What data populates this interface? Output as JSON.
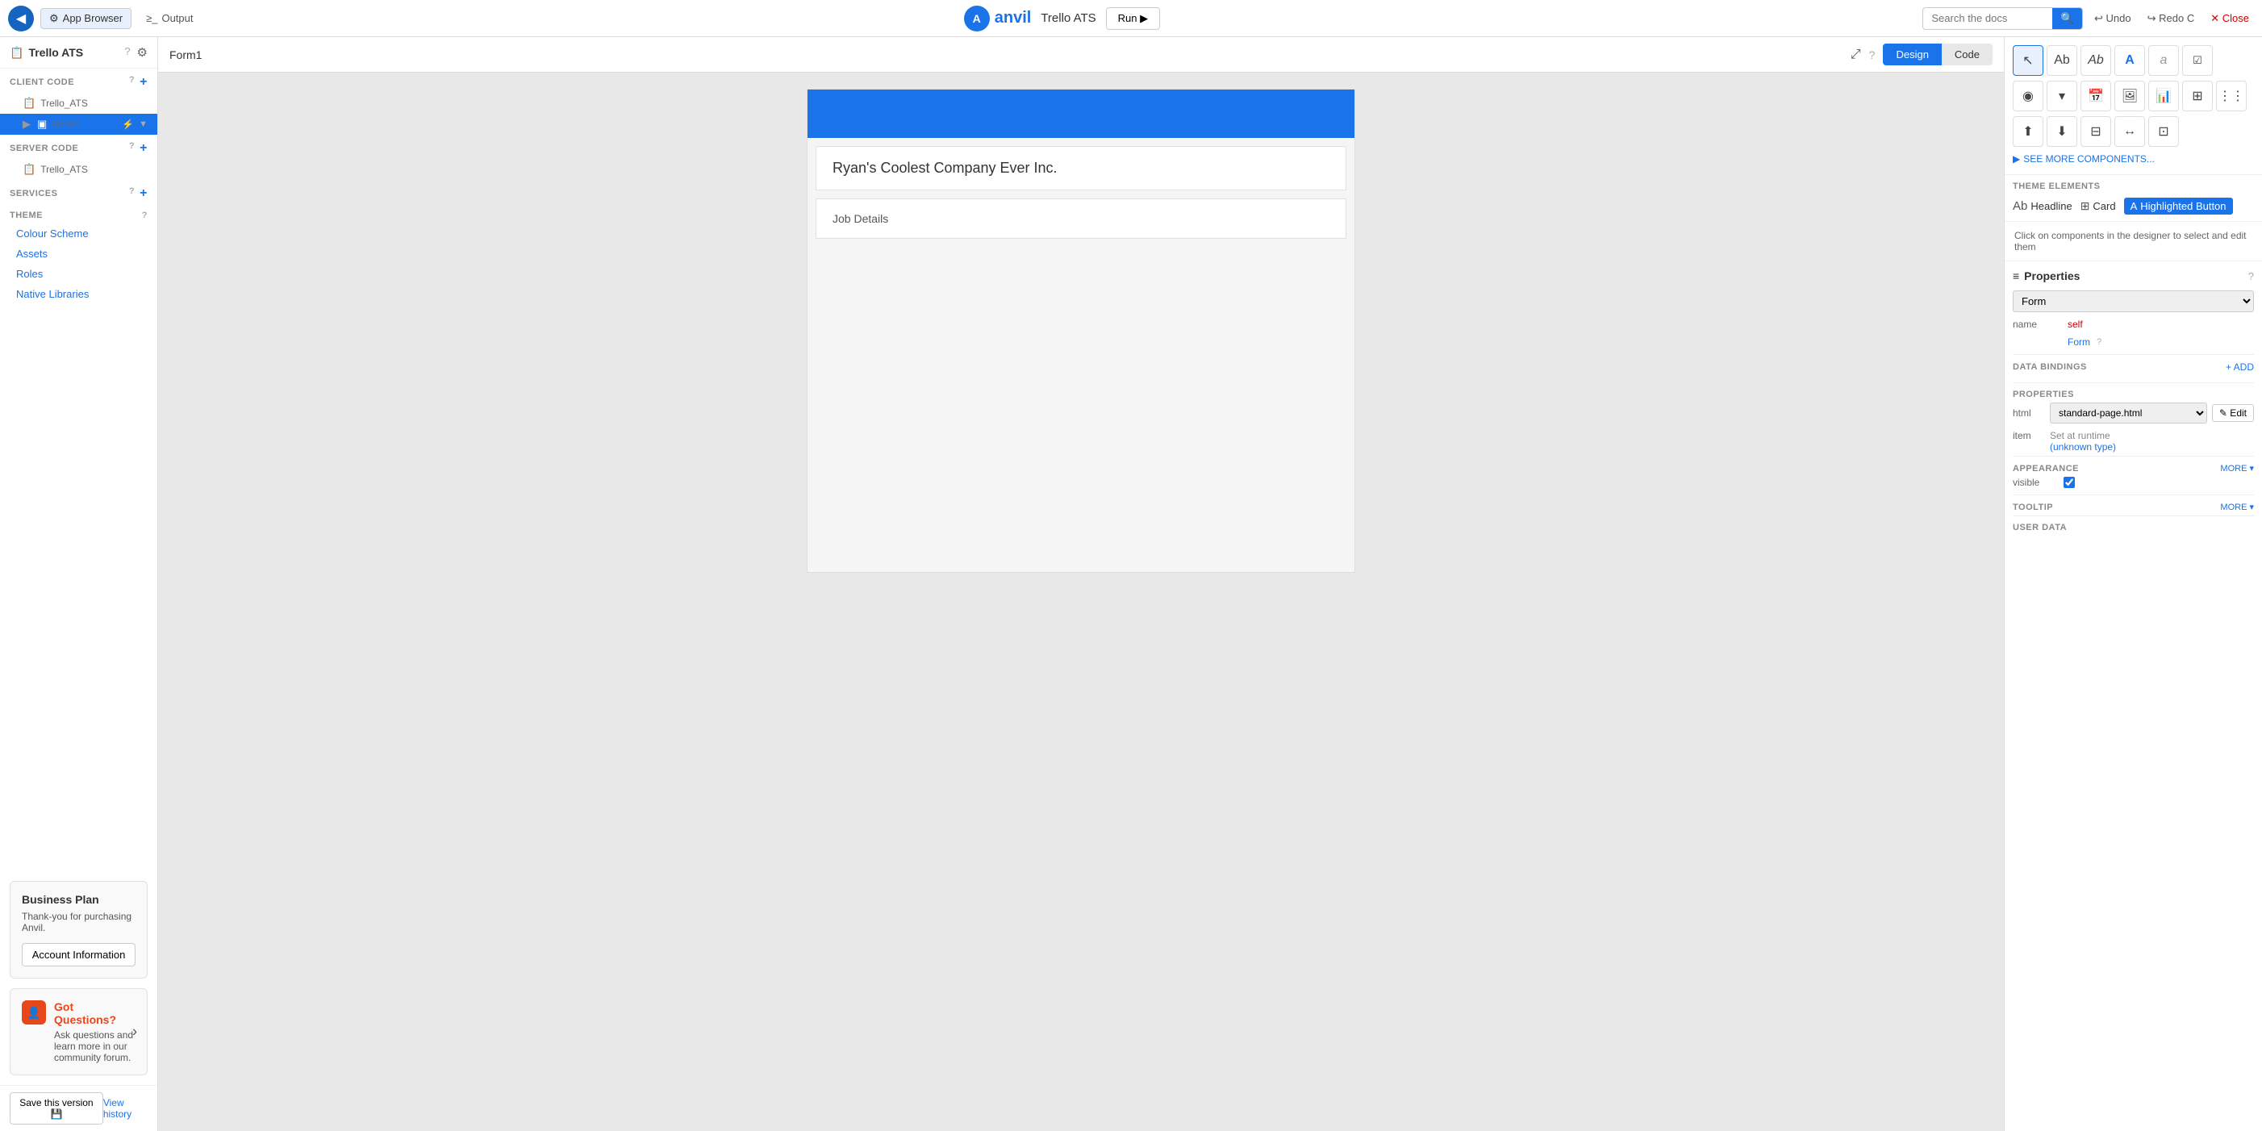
{
  "topbar": {
    "back_btn_label": "◀",
    "app_browser_label": "App Browser",
    "output_label": "Output",
    "anvil_logo_text": "anvil",
    "project_name": "Trello ATS",
    "run_label": "Run ▶",
    "search_placeholder": "Search the docs",
    "undo_label": "Undo",
    "redo_label": "Redo C",
    "close_label": "Close"
  },
  "sidebar": {
    "title": "Trello ATS",
    "sections": {
      "client_code": "CLIENT CODE",
      "server_code": "SERVER CODE",
      "services": "SERVICES",
      "theme": "THEME"
    },
    "client_items": [
      {
        "label": "Trello_ATS",
        "icon": "📋"
      },
      {
        "label": "Form1",
        "icon": "▣",
        "active": true
      }
    ],
    "server_items": [
      {
        "label": "Trello_ATS",
        "icon": "📋"
      }
    ],
    "theme_items": [
      {
        "label": "Colour Scheme"
      },
      {
        "label": "Assets"
      },
      {
        "label": "Roles"
      },
      {
        "label": "Native Libraries"
      }
    ],
    "business_plan": {
      "title": "Business Plan",
      "desc": "Thank-you for purchasing Anvil.",
      "button_label": "Account Information"
    },
    "got_questions": {
      "title": "Got Questions?",
      "desc": "Ask questions and learn more in our community forum."
    },
    "save_btn": "Save this version 💾",
    "view_history": "View history"
  },
  "form_editor": {
    "title": "Form1",
    "design_tab": "Design",
    "code_tab": "Code",
    "canvas": {
      "company_name": "Ryan's Coolest Company Ever Inc.",
      "job_details": "Job Details"
    }
  },
  "right_panel": {
    "see_more_label": "SEE MORE COMPONENTS...",
    "theme_elements_title": "THEME ELEMENTS",
    "theme_headline_label": "Headline",
    "theme_card_label": "Card",
    "theme_hbtn_label": "Highlighted Button",
    "click_hint": "Click on components in the designer to select and edit them",
    "properties_title": "Properties",
    "form_label": "Form",
    "name_label": "name",
    "name_value": "self",
    "form_link": "Form",
    "data_bindings_title": "DATA BINDINGS",
    "add_binding_label": "+ ADD",
    "properties_sub": "PROPERTIES",
    "html_label": "html",
    "html_value": "standard-page.html",
    "edit_btn": "✎ Edit",
    "item_label": "item",
    "item_set_runtime": "Set at runtime",
    "item_unknown": "(unknown type)",
    "appearance_title": "APPEARANCE",
    "more_label": "MORE ▾",
    "visible_label": "visible",
    "tooltip_title": "TOOLTIP",
    "tooltip_more": "MORE ▾",
    "user_data_title": "USER DATA"
  },
  "components": {
    "row1": [
      "cursor",
      "Ab-label",
      "Ab-text",
      "A-button",
      "a-link",
      "A-check"
    ],
    "row2": [
      "radio",
      "dropdown",
      "calendar",
      "image",
      "chart",
      "table",
      "columns"
    ],
    "row3": [
      "upload",
      "align-top",
      "split-col",
      "align-h",
      "align-list"
    ]
  }
}
